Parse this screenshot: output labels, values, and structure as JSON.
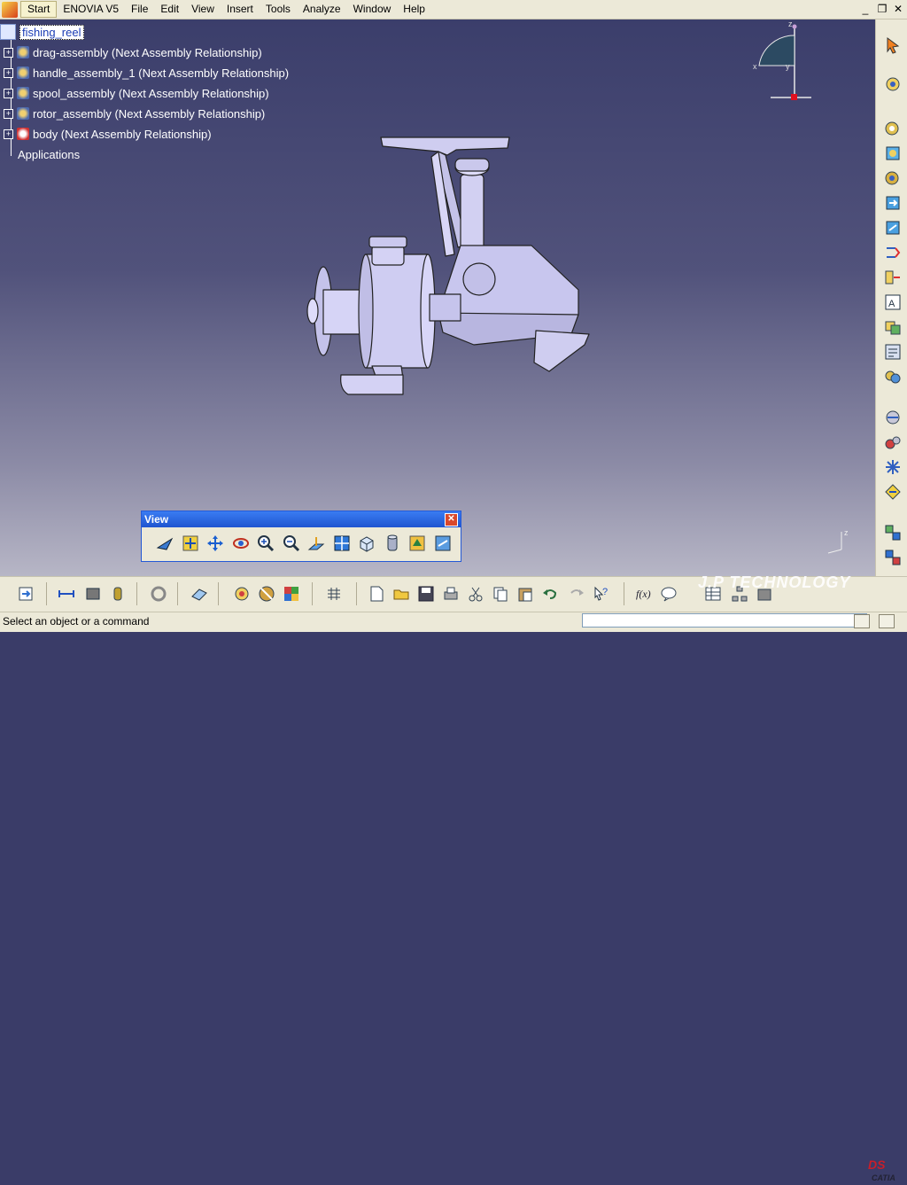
{
  "menu": {
    "start": "Start",
    "items": [
      "ENOVIA V5",
      "File",
      "Edit",
      "View",
      "Insert",
      "Tools",
      "Analyze",
      "Window",
      "Help"
    ]
  },
  "window_controls": [
    "_",
    "❐",
    "✕"
  ],
  "tree": {
    "root": "fishing_reel",
    "children": [
      "drag-assembly (Next Assembly Relationship)",
      "handle_assembly_1 (Next Assembly Relationship)",
      "spool_assembly (Next Assembly Relationship)",
      "rotor_assembly (Next Assembly Relationship)",
      "body (Next Assembly Relationship)"
    ],
    "applications": "Applications"
  },
  "compass": {
    "x": "x",
    "y": "y",
    "z": "z"
  },
  "axis_triad": {
    "z": "z"
  },
  "view_toolbar": {
    "title": "View",
    "buttons": [
      "fly-mode-icon",
      "fit-all-icon",
      "pan-icon",
      "rotate-icon",
      "zoom-in-icon",
      "zoom-out-icon",
      "normal-view-icon",
      "multi-view-icon",
      "iso-view-icon",
      "shading-icon",
      "hide-show-icon",
      "swap-visible-space-icon"
    ]
  },
  "watermark": "J.P TECHNOLOGY",
  "brand": {
    "ds": "DS",
    "catia": "CATIA"
  },
  "status": {
    "text": "Select an object or a command",
    "input_value": ""
  },
  "colors": {
    "viewport_top": "#3b3e6b",
    "viewport_bottom": "#b7b6c6",
    "toolbar_bg": "#ece9d8",
    "title_blue": "#2459d6",
    "part": "#c9c7ec"
  }
}
